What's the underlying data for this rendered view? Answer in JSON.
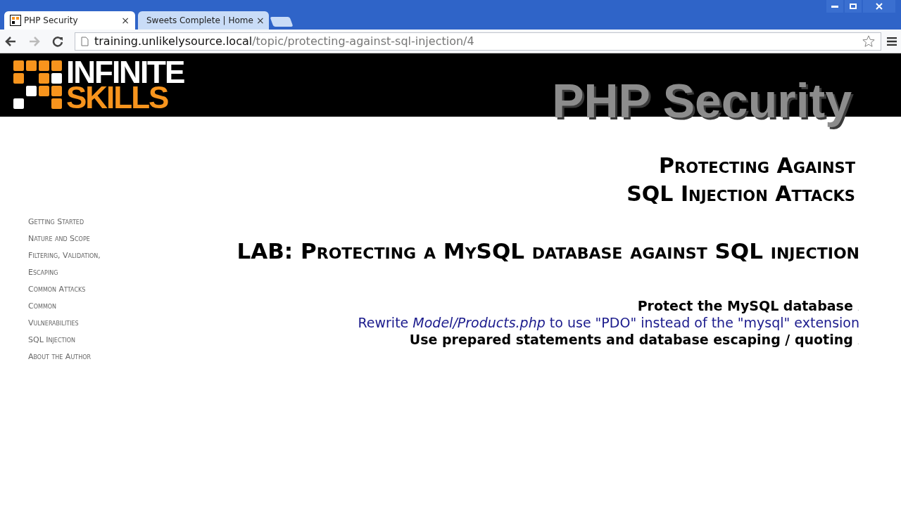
{
  "tabs": [
    {
      "title": "PHP Security",
      "selected": true,
      "close": "×"
    },
    {
      "title": "Sweets Complete | Home",
      "selected": false,
      "close": "×"
    }
  ],
  "address_bar": {
    "host": "training.unlikelysource.local",
    "path": "/topic/protecting-against-sql-injection/4"
  },
  "banner": {
    "logo_top": "INFINITE",
    "logo_bottom": "SKILLS",
    "title": "PHP Security"
  },
  "sidebar": {
    "items": [
      "Getting Started",
      "Nature and Scope",
      "Filtering, Validation,",
      "Escaping",
      "Common Attacks",
      "Common",
      "Vulnerabilities",
      "SQL Injection",
      "About the Author"
    ]
  },
  "content": {
    "title_lines": [
      "Protecting Against",
      "SQL Injection Attacks"
    ],
    "lab_heading": "LAB: Protecting a MySQL database against SQL injection",
    "lines": [
      {
        "kind": "bold",
        "text": "Protect the MySQL database",
        "suffix": "."
      },
      {
        "kind": "link",
        "text": "Rewrite *Model/Products.php* to use \"PDO\" instead of the \"mysql\" extension"
      },
      {
        "kind": "bold",
        "text": "Use prepared statements and database escaping / quoting",
        "suffix": "."
      }
    ]
  }
}
